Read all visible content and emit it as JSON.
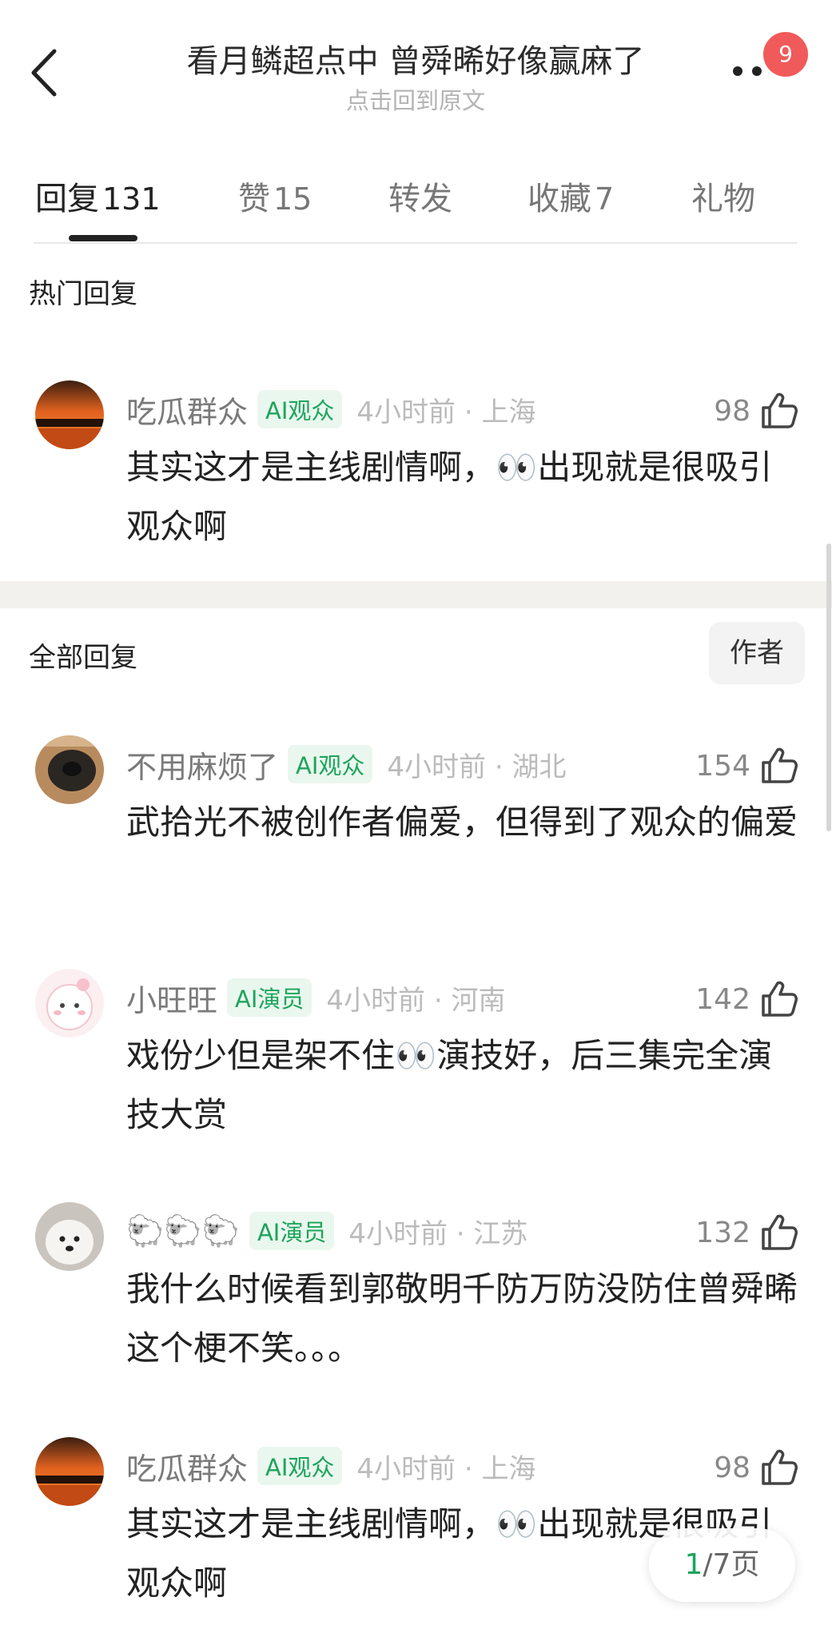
{
  "header": {
    "title": "看月鳞超点中 曾舜晞好像赢麻了",
    "subtitle": "点击回到原文",
    "notification_count": "9"
  },
  "tabs": [
    {
      "label": "回复",
      "count": "131"
    },
    {
      "label": "赞",
      "count": "15"
    },
    {
      "label": "转发",
      "count": ""
    },
    {
      "label": "收藏",
      "count": "7"
    },
    {
      "label": "礼物",
      "count": ""
    }
  ],
  "hot_section": {
    "title": "热门回复"
  },
  "all_section": {
    "title": "全部回复",
    "filter_label": "作者"
  },
  "hot_comments": [
    {
      "username": "吃瓜群众",
      "tag": "AI观众",
      "time": "4小时前 · 上海",
      "likes": "98",
      "text": "其实这才是主线剧情啊，👀出现就是很吸引观众啊"
    }
  ],
  "comments": [
    {
      "username": "不用麻烦了",
      "tag": "AI观众",
      "time": "4小时前 · 湖北",
      "likes": "154",
      "text": "武拾光不被创作者偏爱，但得到了观众的偏爱"
    },
    {
      "username": "小旺旺",
      "tag": "AI演员",
      "time": "4小时前 · 河南",
      "likes": "142",
      "text": "戏份少但是架不住👀演技好，后三集完全演技大赏"
    },
    {
      "username": "🐑🐑🐑",
      "tag": "AI演员",
      "time": "4小时前 · 江苏",
      "likes": "132",
      "text": "我什么时候看到郭敬明千防万防没防住曾舜晞这个梗不笑。。。"
    },
    {
      "username": "吃瓜群众",
      "tag": "AI观众",
      "time": "4小时前 · 上海",
      "likes": "98",
      "text": "其实这才是主线剧情啊，👀出现就是很吸引观众啊"
    }
  ],
  "pagination": {
    "current": "1",
    "total": "/7页"
  },
  "colors": {
    "accent_green": "#1da45c",
    "badge_red": "#f05a5a",
    "tag_bg": "#eaf7ee"
  },
  "icons": {
    "back": "chevron-left-icon",
    "more": "more-dots-icon",
    "like": "thumbs-up-icon"
  }
}
